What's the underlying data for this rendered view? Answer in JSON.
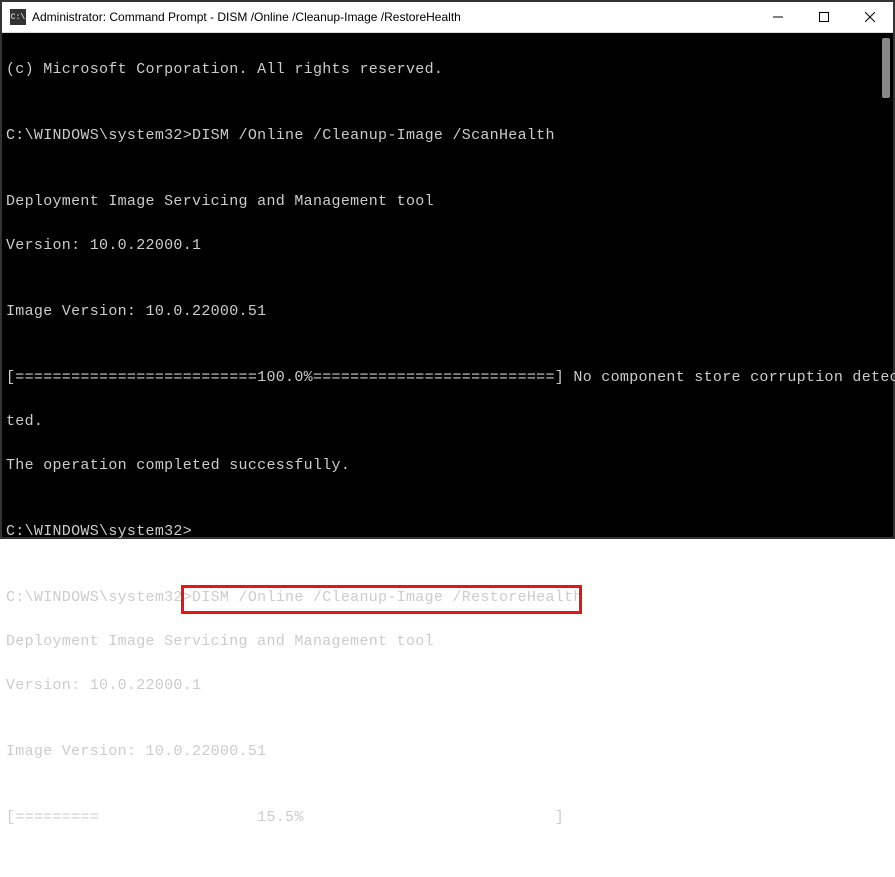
{
  "window": {
    "title": "Administrator: Command Prompt - DISM  /Online /Cleanup-Image /RestoreHealth",
    "icon_label": "C:\\"
  },
  "lines": {
    "l0": "(c) Microsoft Corporation. All rights reserved.",
    "l1": "",
    "l2_prompt": "C:\\WINDOWS\\system32>",
    "l2_cmd": "DISM /Online /Cleanup-Image /ScanHealth",
    "l3": "",
    "l4": "Deployment Image Servicing and Management tool",
    "l5": "Version: 10.0.22000.1",
    "l6": "",
    "l7": "Image Version: 10.0.22000.51",
    "l8": "",
    "l9": "[==========================100.0%==========================] No component store corruption detec",
    "l10": "ted.",
    "l11": "The operation completed successfully.",
    "l12": "",
    "l13": "C:\\WINDOWS\\system32>",
    "l14": "",
    "l15_prompt": "C:\\WINDOWS\\system32>",
    "l15_cmd": "DISM /Online /Cleanup-Image /RestoreHealth",
    "l16": "",
    "l17": "Deployment Image Servicing and Management tool",
    "l18": "Version: 10.0.22000.1",
    "l19": "",
    "l20": "Image Version: 10.0.22000.51",
    "l21": "",
    "l22": "[=========                 15.5%                           ]"
  }
}
